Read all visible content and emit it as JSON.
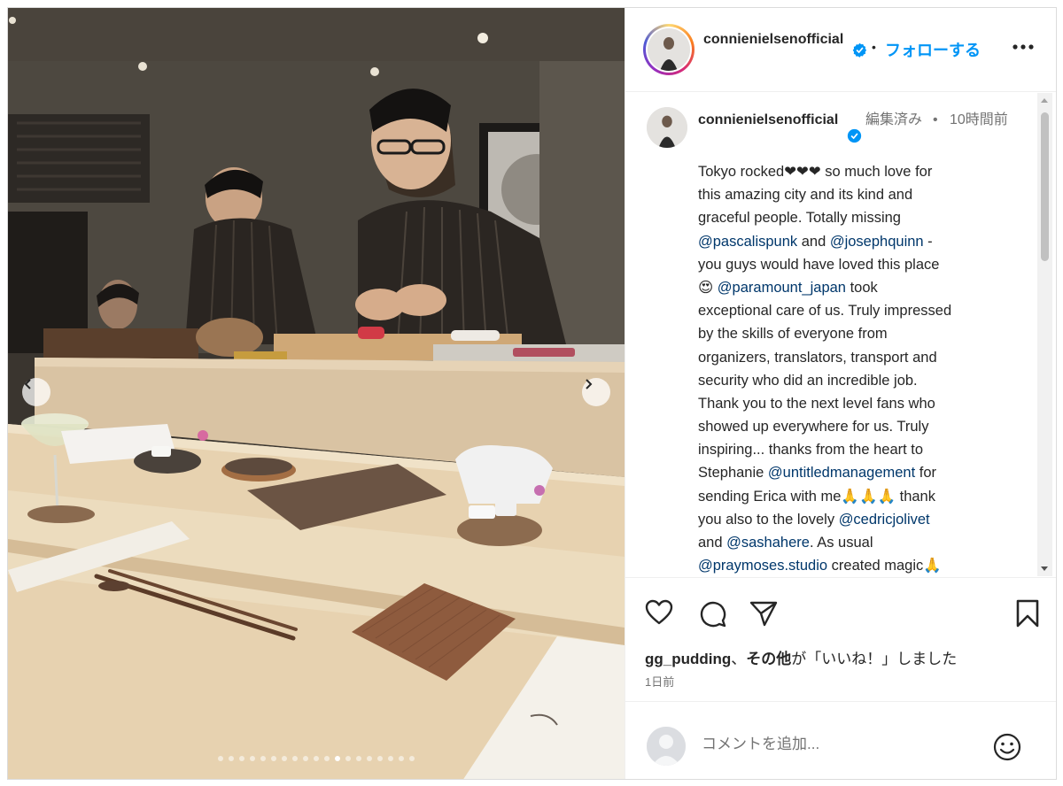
{
  "post": {
    "username": "connienielsenofficial",
    "follow_label": "フォローする",
    "separator": "•",
    "more_icon": "more-horizontal-icon"
  },
  "caption": {
    "username": "connienielsenofficial",
    "edited": "編集済み",
    "dot": "•",
    "time": "10時間前",
    "lines": [
      [
        {
          "t": "Tokyo rocked❤❤❤ so much love for"
        }
      ],
      [
        {
          "t": "this amazing city and its kind and"
        }
      ],
      [
        {
          "t": "graceful people. Totally missing"
        }
      ],
      [
        {
          "t": "@pascalispunk",
          "m": true
        },
        {
          "t": " and "
        },
        {
          "t": "@josephquinn",
          "m": true
        },
        {
          "t": " -"
        }
      ],
      [
        {
          "t": "you guys would have loved this place"
        }
      ],
      [
        {
          "t": "😍 "
        },
        {
          "t": "@paramount_japan",
          "m": true
        },
        {
          "t": " took"
        }
      ],
      [
        {
          "t": "exceptional care of us. Truly impressed"
        }
      ],
      [
        {
          "t": "by the skills of everyone from"
        }
      ],
      [
        {
          "t": "organizers, translators, transport and"
        }
      ],
      [
        {
          "t": "security who did an incredible job."
        }
      ],
      [
        {
          "t": "Thank you to the next level fans who"
        }
      ],
      [
        {
          "t": "showed up everywhere for us. Truly"
        }
      ],
      [
        {
          "t": "inspiring... thanks from the heart to"
        }
      ],
      [
        {
          "t": "Stephanie "
        },
        {
          "t": "@untitledmanagement",
          "m": true
        },
        {
          "t": " for"
        }
      ],
      [
        {
          "t": "sending Erica with me🙏🙏🙏 thank"
        }
      ],
      [
        {
          "t": "you also to the lovely "
        },
        {
          "t": "@cedricjolivet",
          "m": true
        }
      ],
      [
        {
          "t": "and "
        },
        {
          "t": "@sashahere",
          "m": true
        },
        {
          "t": ". As usual"
        }
      ],
      [
        {
          "t": "@praymoses.studio",
          "m": true
        },
        {
          "t": " created magic🙏"
        }
      ],
      [
        {
          "t": "🙏"
        }
      ]
    ]
  },
  "actions": {
    "like_icon": "heart-icon",
    "comment_icon": "comment-icon",
    "share_icon": "share-icon",
    "save_icon": "bookmark-icon"
  },
  "likes": {
    "user": "gg_pudding",
    "sep": "、",
    "others": "その他",
    "suffix": "が「いいね！」しました"
  },
  "post_age": "1日前",
  "comment": {
    "placeholder": "コメントを追加...",
    "emoji_icon": "emoji-icon"
  },
  "carousel": {
    "total": 19,
    "active": 11
  },
  "colors": {
    "accent": "#0095f6",
    "mention": "#00376b",
    "verified": "#0095f6",
    "muted": "#737373"
  }
}
